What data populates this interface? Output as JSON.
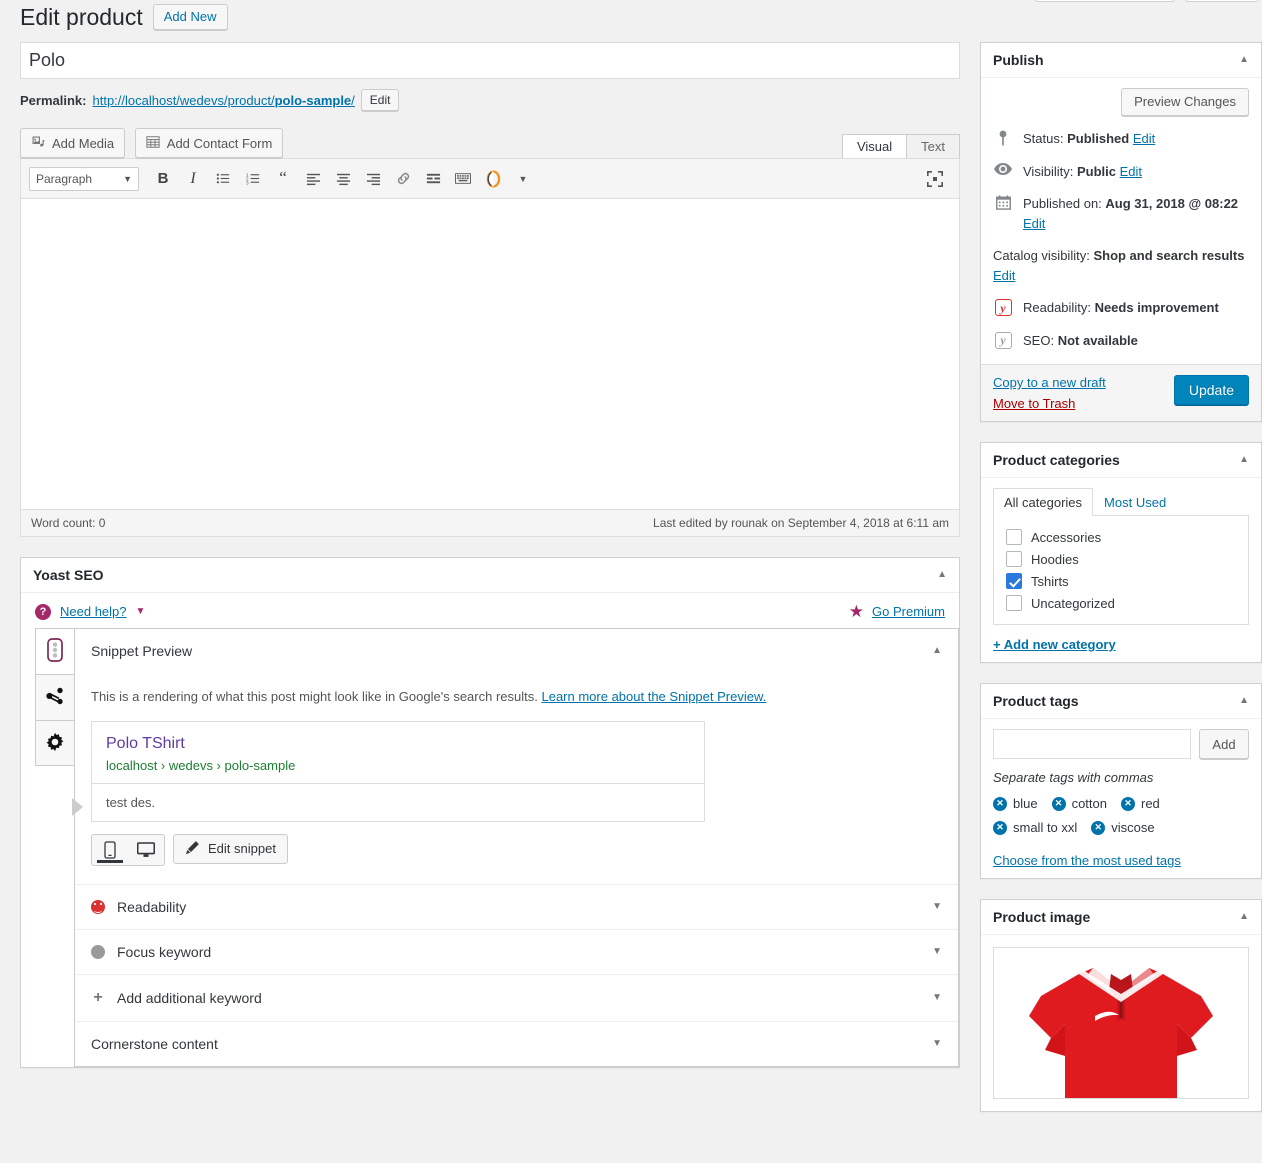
{
  "header": {
    "page_title": "Edit product",
    "add_new_label": "Add New"
  },
  "post": {
    "title_value": "Polo",
    "permalink_label": "Permalink:",
    "permalink_prefix": "http://localhost/wedevs/product/",
    "permalink_slug": "polo-sample",
    "permalink_suffix": "/",
    "permalink_edit_label": "Edit"
  },
  "editor": {
    "add_media_label": "Add Media",
    "add_contact_form_label": "Add Contact Form",
    "tab_visual": "Visual",
    "tab_text": "Text",
    "format_select_value": "Paragraph",
    "toolbar_buttons": [
      "bold-icon",
      "italic-icon",
      "bulleted-list-icon",
      "numbered-list-icon",
      "blockquote-icon",
      "align-left-icon",
      "align-center-icon",
      "align-right-icon",
      "insert-link-icon",
      "read-more-icon",
      "keyboard-shortcuts-icon",
      "omega-plugin-icon",
      "toolbar-toggle-icon"
    ],
    "fullscreen_icon": "distraction-free-icon",
    "content_value": "",
    "word_count": "Word count: 0",
    "last_edited": "Last edited by rounak on September 4, 2018 at 6:11 am"
  },
  "yoast": {
    "panel_title": "Yoast SEO",
    "need_help_label": "Need help?",
    "go_premium_label": "Go Premium",
    "tabs": [
      {
        "name": "seo-tab",
        "icon": "traffic-light-icon",
        "active": true
      },
      {
        "name": "social-tab",
        "icon": "share-icon",
        "active": false
      },
      {
        "name": "settings-tab",
        "icon": "gear-icon",
        "active": false
      }
    ],
    "snippet": {
      "heading": "Snippet Preview",
      "description_intro": "This is a rendering of what this post might look like in Google's search results.",
      "learn_more_label": "Learn more about the Snippet Preview.",
      "serp_title": "Polo TShirt",
      "serp_url": "localhost › wedevs › polo-sample",
      "serp_meta": "test des.",
      "device_mobile": "mobile-preview-icon",
      "device_desktop": "desktop-preview-icon",
      "edit_snippet_label": "Edit snippet"
    },
    "accordions": [
      {
        "label": "Readability",
        "bullet": "red"
      },
      {
        "label": "Focus keyword",
        "bullet": "grey"
      },
      {
        "label": "Add additional keyword",
        "bullet": "plus"
      },
      {
        "label": "Cornerstone content",
        "bullet": "none"
      }
    ]
  },
  "publish": {
    "panel_title": "Publish",
    "preview_label": "Preview Changes",
    "status_label": "Status:",
    "status_value": "Published",
    "status_edit": "Edit",
    "visibility_label": "Visibility:",
    "visibility_value": "Public",
    "visibility_edit": "Edit",
    "published_label": "Published on:",
    "published_value": "Aug 31, 2018 @ 08:22",
    "published_edit": "Edit",
    "catalog_label": "Catalog visibility:",
    "catalog_value": "Shop and search results",
    "catalog_edit": "Edit",
    "readability_label": "Readability:",
    "readability_value": "Needs improvement",
    "seo_label": "SEO:",
    "seo_value": "Not available",
    "copy_draft_label": "Copy to a new draft",
    "move_trash_label": "Move to Trash",
    "update_label": "Update"
  },
  "categories": {
    "panel_title": "Product categories",
    "tab_all": "All categories",
    "tab_most_used": "Most Used",
    "items": [
      {
        "label": "Accessories",
        "checked": false
      },
      {
        "label": "Hoodies",
        "checked": false
      },
      {
        "label": "Tshirts",
        "checked": true
      },
      {
        "label": "Uncategorized",
        "checked": false
      }
    ],
    "add_new_label": "+ Add new category"
  },
  "tags": {
    "panel_title": "Product tags",
    "input_value": "",
    "add_label": "Add",
    "hint": "Separate tags with commas",
    "items": [
      "blue",
      "cotton",
      "red",
      "small to xxl",
      "viscose"
    ],
    "choose_label": "Choose from the most used tags"
  },
  "product_image": {
    "panel_title": "Product image",
    "alt": "red-polo-shirt-photo",
    "brand_mark": "joma-swoosh-logo"
  },
  "colors": {
    "accent": "#0073aa",
    "update_button": "#0085ba",
    "yoast_purple": "#a4286a",
    "danger": "#a00",
    "checkbox_checked": "#2a7ade",
    "serp_title": "#5f3ba5",
    "serp_url": "#1e7e34",
    "shirt_red": "#e01b20"
  }
}
